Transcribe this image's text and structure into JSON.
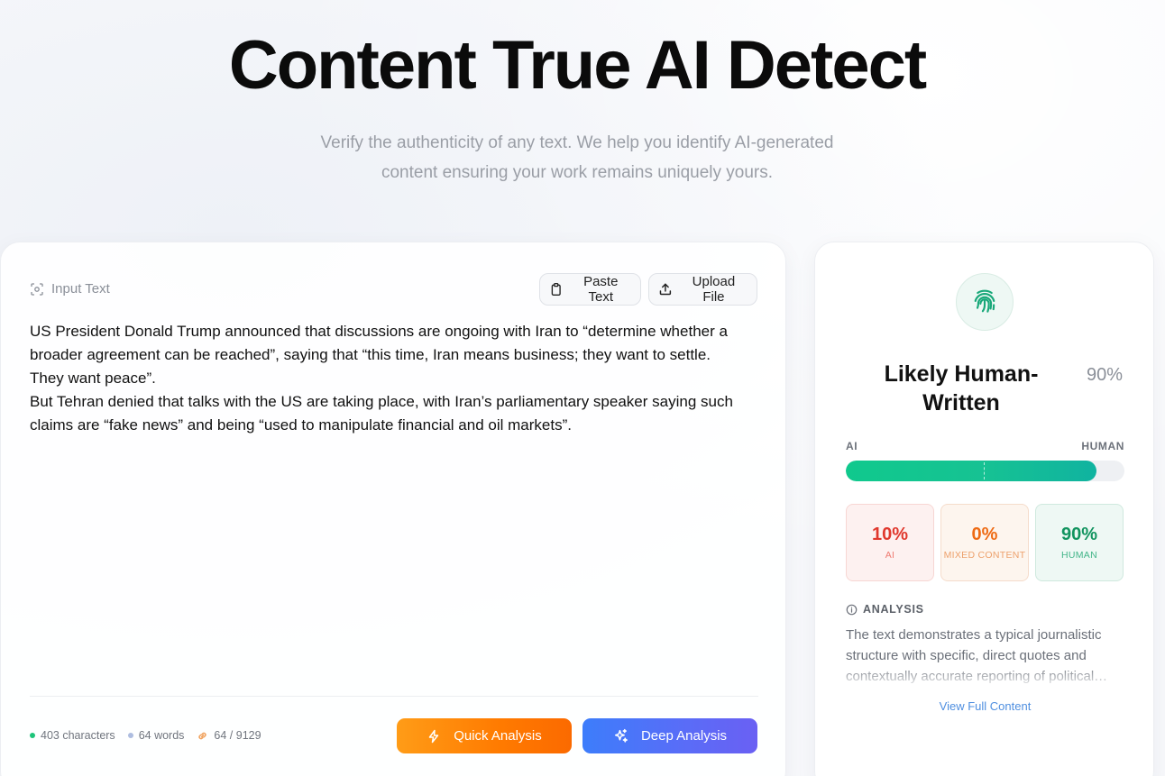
{
  "hero": {
    "title": "Content True AI Detect",
    "subtitle_line1": "Verify the authenticity of any text. We help you identify AI-generated",
    "subtitle_line2": "content ensuring your work remains uniquely yours."
  },
  "input": {
    "label": "Input Text",
    "paste_label": "Paste Text",
    "upload_label": "Upload File",
    "text": "US President Donald Trump announced that discussions are ongoing with Iran to “determine whether a\nbroader agreement can be reached”, saying that “this time, Iran means business; they want to settle.\nThey want peace”.\nBut Tehran denied that talks with the US are taking place, with Iran’s parliamentary speaker saying such\nclaims are “fake news” and being “used to manipulate financial and oil markets”.",
    "stats": {
      "characters": "403 characters",
      "words": "64 words",
      "tokens": "64 / 9129"
    },
    "quick_label": "Quick Analysis",
    "deep_label": "Deep Analysis"
  },
  "result": {
    "verdict": "Likely Human-Written",
    "verdict_pct": "90%",
    "bar": {
      "left_label": "AI",
      "right_label": "HUMAN",
      "human_fraction": 0.9
    },
    "scores": {
      "ai_value": "10%",
      "ai_label": "AI",
      "mixed_value": "0%",
      "mixed_label": "MIXED CONTENT",
      "human_value": "90%",
      "human_label": "HUMAN"
    },
    "analysis_heading": "ANALYSIS",
    "analysis_text": "The text demonstrates a typical journalistic structure with specific, direct quotes and contextually accurate reporting of political…",
    "view_full_label": "View Full Content"
  },
  "colors": {
    "accent_green": "#12945f",
    "accent_red": "#e0382d",
    "accent_orange": "#ee6a13",
    "link_blue": "#4f8fe0"
  },
  "icons": [
    "scan-icon",
    "clipboard-icon",
    "upload-icon",
    "lightning-icon",
    "sparkles-icon",
    "fingerprint-icon",
    "info-icon",
    "link-icon"
  ]
}
